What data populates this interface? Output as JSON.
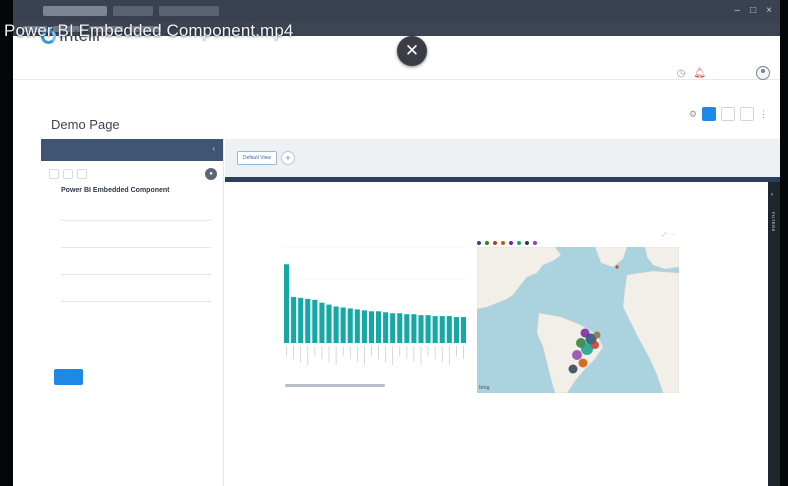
{
  "video": {
    "title": "Power BI Embedded Component.mp4",
    "close_icon": "close-icon"
  },
  "browser": {
    "win_min": "–",
    "win_max": "□",
    "win_close": "×"
  },
  "app": {
    "logo_text": "Intelli",
    "logo_sub": "",
    "user_name": "",
    "colors": {
      "brand_blue": "#1e88e5",
      "panel_head": "#3e5573",
      "report_bar": "#2c3e5c",
      "teal": "#14a9a6"
    }
  },
  "page": {
    "breadcrumb": "",
    "title": "Demo Page",
    "actions": {
      "edit_label": "",
      "preview_label": "",
      "save_label": ""
    }
  },
  "left_panel": {
    "header": "",
    "tabs": [
      "",
      "",
      ""
    ],
    "component_title": "Power BI Embedded Component",
    "fields": [
      {
        "label": "",
        "value": ""
      },
      {
        "label": "",
        "value": ""
      },
      {
        "label": "",
        "value": ""
      },
      {
        "label": "",
        "value": ""
      }
    ],
    "submit_label": ""
  },
  "content": {
    "default_view_label": "Default View",
    "add_view_label": "+",
    "filters_label": "FILTERS"
  },
  "chart_data": {
    "type": "bar",
    "title": "",
    "xlabel": "",
    "ylabel": "",
    "categories": [
      "",
      "",
      "",
      "",
      "",
      "",
      "",
      "",
      "",
      "",
      "",
      "",
      "",
      "",
      "",
      "",
      "",
      "",
      "",
      "",
      "",
      "",
      "",
      "",
      "",
      ""
    ],
    "values": [
      82,
      48,
      47,
      46,
      45,
      42,
      40,
      38,
      37,
      36,
      35,
      34,
      33,
      33,
      32,
      31,
      31,
      30,
      30,
      29,
      29,
      28,
      28,
      28,
      27,
      27
    ],
    "ylim": [
      0,
      100
    ],
    "color": "#14a9a6"
  },
  "map": {
    "title": "",
    "legend": [
      {
        "name": "",
        "color": "#1f4e79"
      },
      {
        "name": "",
        "color": "#2e7d32"
      },
      {
        "name": "",
        "color": "#c0392b"
      },
      {
        "name": "",
        "color": "#d35400"
      },
      {
        "name": "",
        "color": "#7b1fa2"
      },
      {
        "name": "",
        "color": "#16a085"
      },
      {
        "name": "",
        "color": "#2c3e50"
      },
      {
        "name": "",
        "color": "#8e44ad"
      }
    ],
    "attribution": "bing",
    "colors": {
      "ocean": "#aad3df",
      "land": "#f2efe9"
    }
  }
}
